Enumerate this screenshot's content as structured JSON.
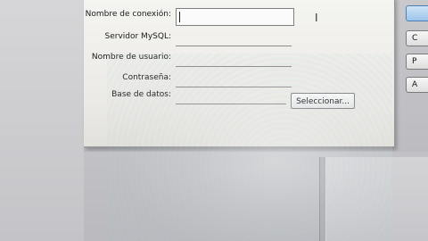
{
  "dialog": {
    "fields": [
      {
        "label": "Nombre de conexión:",
        "value": ""
      },
      {
        "label": "Servidor MySQL:",
        "value": ""
      },
      {
        "label": "Nombre de usuario:",
        "value": ""
      },
      {
        "label": "Contraseña:",
        "value": ""
      },
      {
        "label": "Base de datos:",
        "value": ""
      }
    ],
    "select_button": "Seleccionar...",
    "side_buttons": [
      "",
      "C",
      "P",
      "A"
    ]
  }
}
